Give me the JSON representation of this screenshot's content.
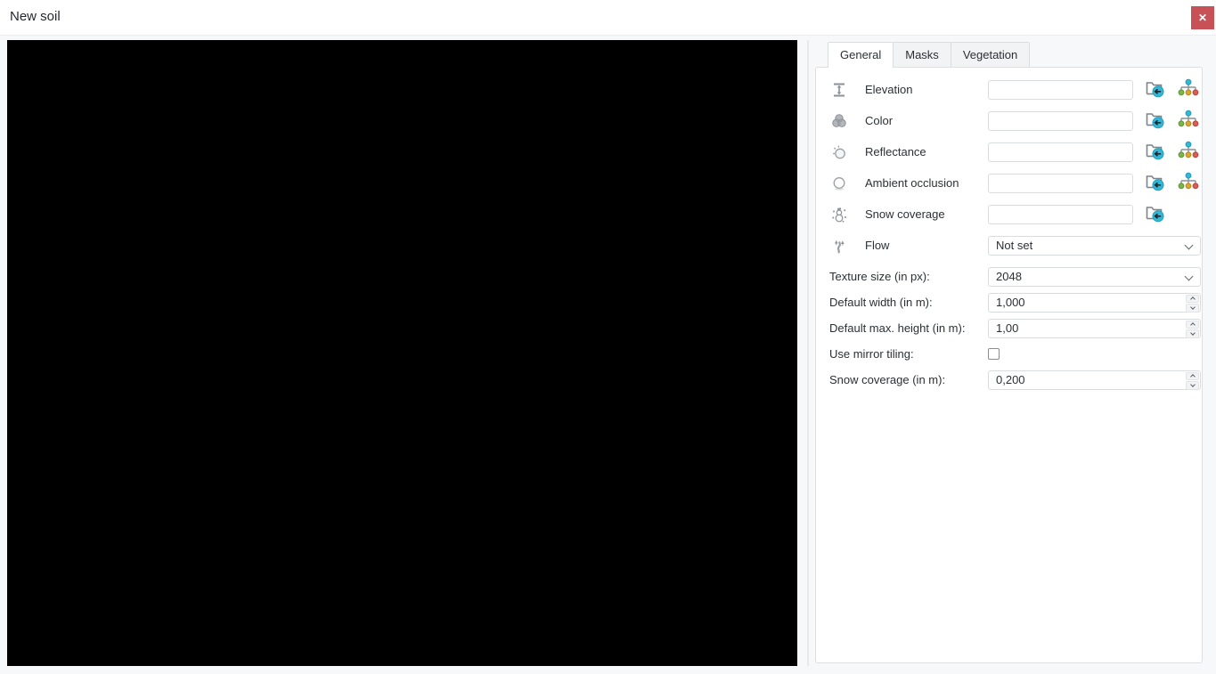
{
  "window": {
    "title": "New soil",
    "close_icon": "✕"
  },
  "panel": {
    "tabs": [
      {
        "label": "General",
        "active": true
      },
      {
        "label": "Masks",
        "active": false
      },
      {
        "label": "Vegetation",
        "active": false
      }
    ],
    "rows": [
      {
        "label": "Elevation",
        "value": "",
        "icon": "elevation-icon"
      },
      {
        "label": "Color",
        "value": "",
        "icon": "color-icon"
      },
      {
        "label": "Reflectance",
        "value": "",
        "icon": "reflectance-icon"
      },
      {
        "label": "Ambient occlusion",
        "value": "",
        "icon": "ambient-occlusion-icon"
      },
      {
        "label": "Snow coverage",
        "value": "",
        "icon": "snow-coverage-icon"
      }
    ],
    "flow": {
      "label": "Flow",
      "value": "Not set",
      "icon": "flow-icon"
    },
    "fields": {
      "texture_size": {
        "label": "Texture size (in px):",
        "value": "2048"
      },
      "default_width": {
        "label": "Default width (in m):",
        "value": "1,000"
      },
      "default_max_height": {
        "label": "Default max. height (in m):",
        "value": "1,00"
      },
      "use_mirror_tiling": {
        "label": "Use mirror tiling:",
        "checked": false
      },
      "snow_coverage_m": {
        "label": "Snow coverage (in m):",
        "value": "0,200"
      }
    }
  },
  "colors": {
    "close_button": "#c75156",
    "accent_cyan": "#35b8d6",
    "node_green": "#7ab648",
    "node_yellow": "#d9a62e",
    "node_red": "#d95c55",
    "icon_gray": "#8b9196"
  }
}
